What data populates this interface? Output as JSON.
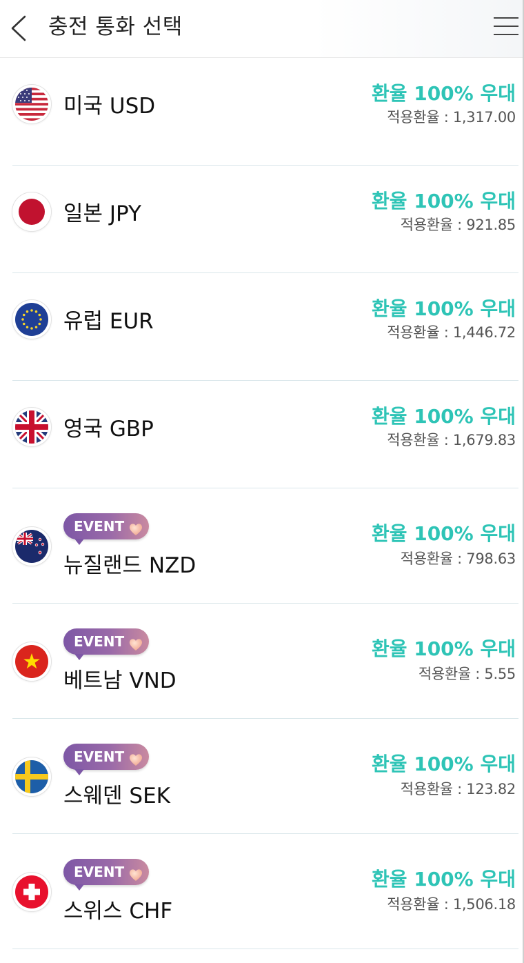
{
  "header": {
    "title": "충전 통화 선택",
    "back_icon": "chevron-left-icon",
    "menu_icon": "hamburger-menu-icon"
  },
  "colors": {
    "accent": "#2ec4b6",
    "badge_start": "#7d57a6",
    "badge_end": "#c98aa0",
    "divider": "#d9e6ea"
  },
  "currencies": [
    {
      "name": "미국 USD",
      "flag": "us-flag-icon",
      "event": false,
      "rate_title": "환율 100% 우대",
      "rate_value": "적용환율 : 1,317.00"
    },
    {
      "name": "일본 JPY",
      "flag": "jp-flag-icon",
      "event": false,
      "rate_title": "환율 100% 우대",
      "rate_value": "적용환율 : 921.85"
    },
    {
      "name": "유럽 EUR",
      "flag": "eu-flag-icon",
      "event": false,
      "rate_title": "환율 100% 우대",
      "rate_value": "적용환율 : 1,446.72"
    },
    {
      "name": "영국 GBP",
      "flag": "uk-flag-icon",
      "event": false,
      "rate_title": "환율 100% 우대",
      "rate_value": "적용환율 : 1,679.83"
    },
    {
      "name": "뉴질랜드 NZD",
      "flag": "nz-flag-icon",
      "event": true,
      "badge": "EVENT",
      "rate_title": "환율 100% 우대",
      "rate_value": "적용환율 : 798.63"
    },
    {
      "name": "베트남 VND",
      "flag": "vn-flag-icon",
      "event": true,
      "badge": "EVENT",
      "rate_title": "환율 100% 우대",
      "rate_value": "적용환율 : 5.55"
    },
    {
      "name": "스웨덴 SEK",
      "flag": "se-flag-icon",
      "event": true,
      "badge": "EVENT",
      "rate_title": "환율 100% 우대",
      "rate_value": "적용환율 : 123.82"
    },
    {
      "name": "스위스 CHF",
      "flag": "ch-flag-icon",
      "event": true,
      "badge": "EVENT",
      "rate_title": "환율 100% 우대",
      "rate_value": "적용환율 : 1,506.18"
    }
  ]
}
